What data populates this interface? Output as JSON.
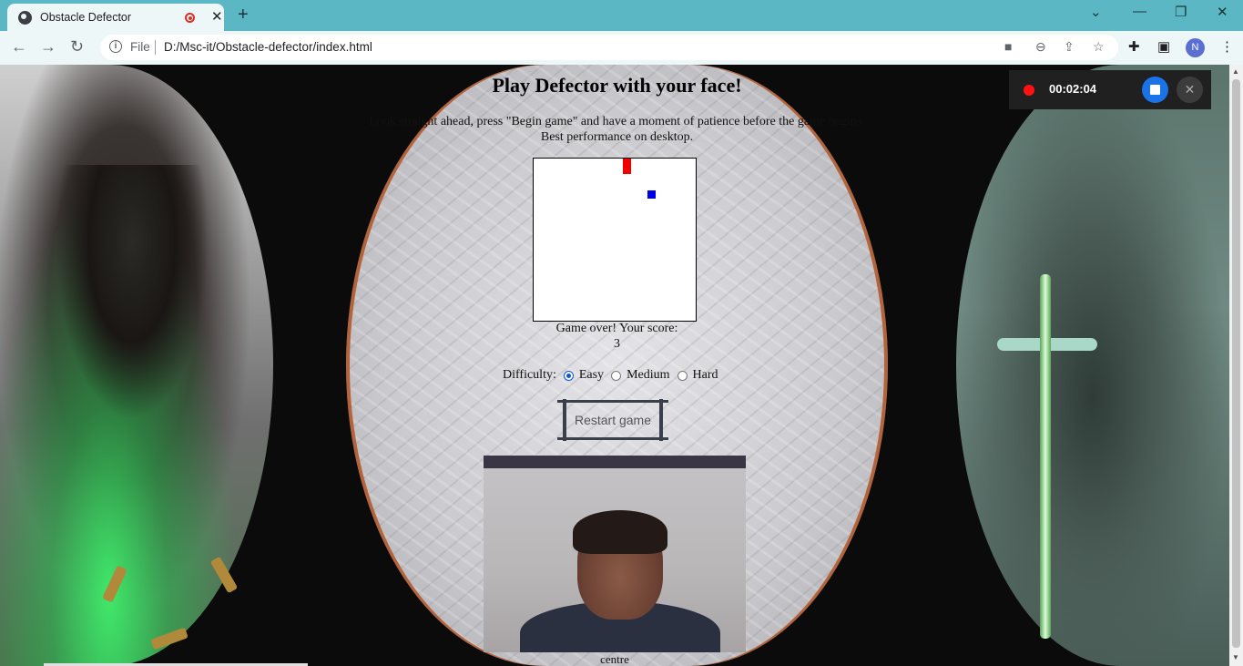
{
  "browser": {
    "tab_title": "Obstacle Defector",
    "tab_close": "✕",
    "new_tab": "+",
    "file_label": "File",
    "url": "D:/Msc-it/Obstacle-defector/index.html",
    "profile_initial": "N",
    "icons": [
      "back-arrow",
      "forward-arrow",
      "reload",
      "site-info",
      "camera",
      "zoom",
      "share",
      "bookmark-star",
      "extensions",
      "side-panel",
      "more-menu"
    ]
  },
  "game": {
    "title": "Play Defector with your face!",
    "instructions_line1": "Look straight ahead, press \"Begin game\" and have a moment of patience before the game begins.",
    "instructions_line2": "Best performance on desktop.",
    "score_label": "Game over! Your score:",
    "score": "3",
    "difficulty_label": "Difficulty:",
    "difficulty_options": [
      "Easy",
      "Medium",
      "Hard"
    ],
    "difficulty_selected": "Easy",
    "restart_label": "Restart game",
    "face_position": "centre",
    "obstacle_color": "#f20000",
    "player_color": "#0000e6"
  },
  "recorder": {
    "elapsed": "00:02:04",
    "status_color": "#ff1111",
    "stop_color": "#1a73e8"
  }
}
